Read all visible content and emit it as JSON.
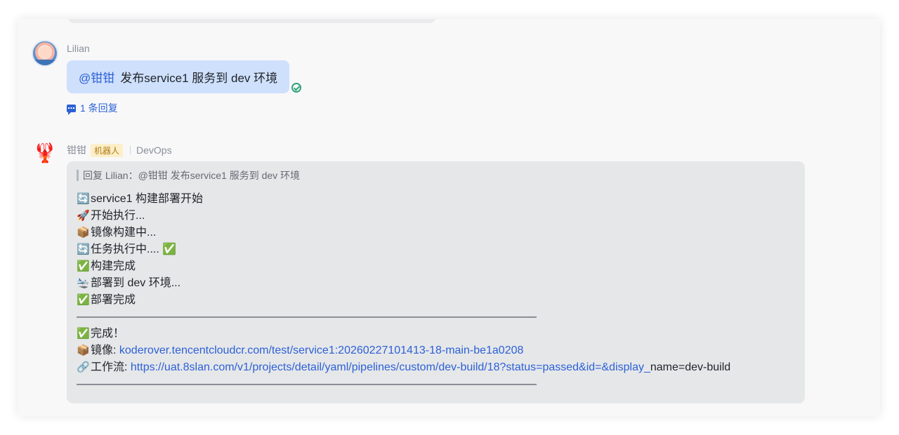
{
  "messages": {
    "lilian": {
      "sender": "Lilian",
      "mention": "@钳钳",
      "text": "发布service1 服务到 dev 环境",
      "reply_count": "1 条回复"
    },
    "bot": {
      "sender": "钳钳",
      "badge": "机器人",
      "org": "DevOps",
      "quote": "回复 Lilian：@钳钳 发布service1 服务到 dev 环境",
      "lines": [
        {
          "emoji": "🔄",
          "text": "service1 构建部署开始"
        },
        {
          "emoji": "🚀",
          "text": "开始执行..."
        },
        {
          "emoji": "📦",
          "text": "镜像构建中..."
        },
        {
          "emoji": "🔄",
          "text": "任务执行中....",
          "trail": "✅"
        },
        {
          "emoji": "✅",
          "text": "构建完成"
        },
        {
          "emoji": "🛬",
          "text": "部署到 dev 环境..."
        },
        {
          "emoji": "✅",
          "text": "部署完成"
        }
      ],
      "done": {
        "emoji": "✅",
        "text": "完成！"
      },
      "image": {
        "emoji": "📦",
        "label": "镜像: ",
        "url": "koderover.tencentcloudcr.com/test/service1:20260227101413-18-main-be1a0208"
      },
      "workflow": {
        "emoji": "🔗",
        "label": "工作流: ",
        "url": "https://uat.8slan.com/v1/projects/detail/yaml/pipelines/custom/dev-build/18?status=passed&id=&display_",
        "suffix": "name=dev-build"
      }
    }
  },
  "icons": {
    "bot_avatar": "lobster-icon",
    "reply": "comment-icon",
    "read": "check-circle-icon"
  },
  "colors": {
    "accent": "#2c61d6",
    "user_bubble": "#cfe0fc",
    "bot_bubble": "#e6e7e9",
    "read": "#2fa37a"
  }
}
